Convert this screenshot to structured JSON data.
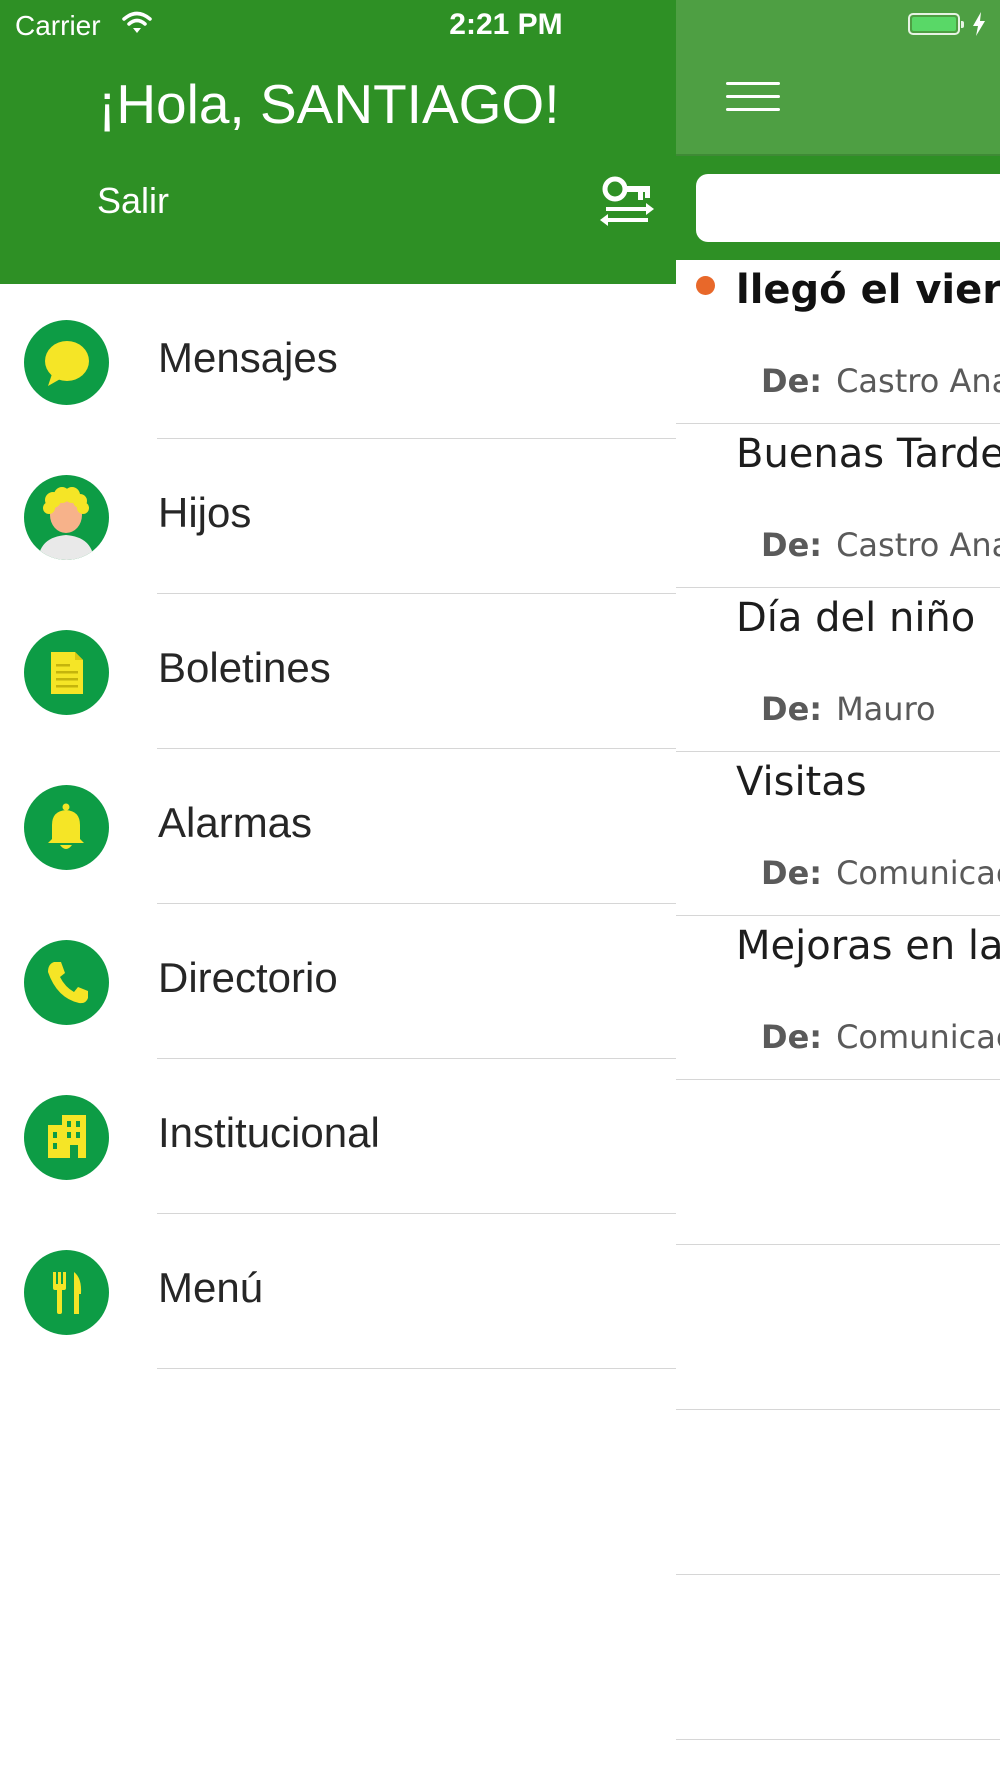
{
  "status_bar": {
    "carrier": "Carrier",
    "time": "2:21 PM"
  },
  "colors": {
    "header_green": "#2e9025",
    "main_green": "#4e9f43",
    "icon_circle": "#0d9c45",
    "icon_yellow": "#f5e526",
    "unread_dot": "#e8682a"
  },
  "drawer": {
    "greeting": "¡Hola, SANTIAGO!",
    "logout_label": "Salir",
    "settings_icon": "key-settings-icon",
    "items": [
      {
        "label": "Mensajes",
        "icon": "chat-bubble-icon"
      },
      {
        "label": "Hijos",
        "icon": "child-avatar-icon"
      },
      {
        "label": "Boletines",
        "icon": "document-icon"
      },
      {
        "label": "Alarmas",
        "icon": "bell-icon"
      },
      {
        "label": "Directorio",
        "icon": "phone-icon"
      },
      {
        "label": "Institucional",
        "icon": "building-icon"
      },
      {
        "label": "Menú",
        "icon": "fork-knife-icon"
      }
    ]
  },
  "main": {
    "search_placeholder": "",
    "messages": [
      {
        "subject": "llegó el viern",
        "from_label": "De:",
        "from": "Castro Ana",
        "unread": true
      },
      {
        "subject": "Buenas Tardes",
        "from_label": "De:",
        "from": "Castro Ana",
        "unread": false
      },
      {
        "subject": "Día del niño",
        "from_label": "De:",
        "from": "Mauro",
        "unread": false
      },
      {
        "subject": "Visitas",
        "from_label": "De:",
        "from": "Comunicaci",
        "unread": false
      },
      {
        "subject": "Mejoras en la",
        "from_label": "De:",
        "from": "Comunicaci",
        "unread": false
      }
    ]
  }
}
